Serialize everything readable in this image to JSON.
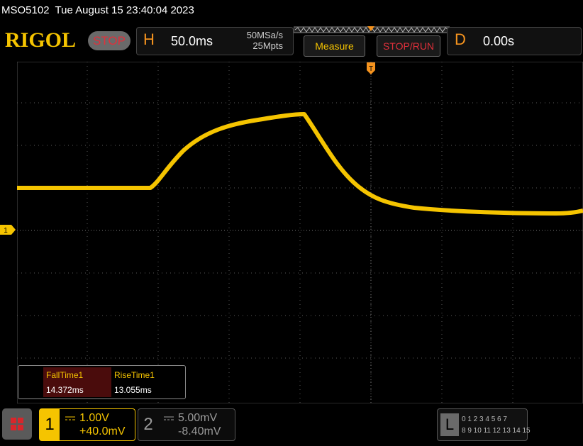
{
  "header": {
    "model": "MSO5102",
    "datetime": "Tue August 15 23:40:04 2023",
    "brand": "RIGOL",
    "run_state": "STOP"
  },
  "timebase": {
    "letter": "H",
    "scale": "50.0ms",
    "sample_rate": "50MSa/s",
    "memory_depth": "25Mpts"
  },
  "toolbar": {
    "measure_label": "Measure",
    "stoprun_label": "STOP/RUN"
  },
  "delay": {
    "letter": "D",
    "value": "0.00s"
  },
  "screen": {
    "ch1_marker": "1",
    "trigger_marker": "T"
  },
  "measurements": {
    "fall_label": "FallTime1",
    "fall_value": "14.372ms",
    "rise_label": "RiseTime1",
    "rise_value": "13.055ms"
  },
  "channels": {
    "ch1": {
      "number": "1",
      "scale": "1.00V",
      "offset": "+40.0mV"
    },
    "ch2": {
      "number": "2",
      "scale": "5.00mV",
      "offset": "-8.40mV"
    }
  },
  "logic": {
    "letter": "L",
    "row1": "0 1 2 3   4 5 6 7",
    "row2": "8  9 10 11  12 13 14 15"
  },
  "colors": {
    "ch1": "#f5c400",
    "trigger": "#f5931e",
    "stop": "#e0303b",
    "grid": "#5a5a5a"
  }
}
